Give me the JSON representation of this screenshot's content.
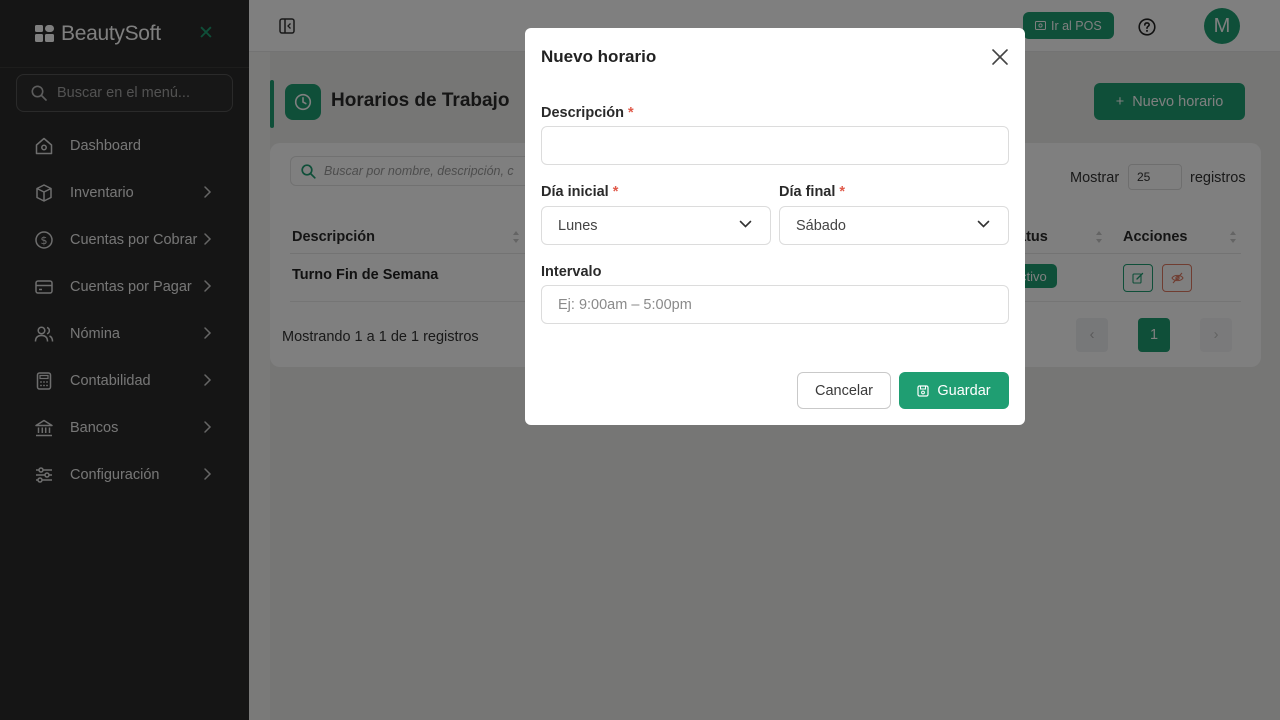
{
  "sidebar": {
    "brand": "BeautySoft",
    "search_placeholder": "Buscar en el menú...",
    "items": [
      {
        "label": "Dashboard",
        "icon": "home-icon",
        "has_chevron": false
      },
      {
        "label": "Inventario",
        "icon": "box-icon",
        "has_chevron": true
      },
      {
        "label": "Cuentas por Cobrar",
        "icon": "dollar-circle-icon",
        "has_chevron": true
      },
      {
        "label": "Cuentas por Pagar",
        "icon": "credit-card-icon",
        "has_chevron": true
      },
      {
        "label": "Nómina",
        "icon": "users-icon",
        "has_chevron": true
      },
      {
        "label": "Contabilidad",
        "icon": "calculator-icon",
        "has_chevron": true
      },
      {
        "label": "Bancos",
        "icon": "bank-icon",
        "has_chevron": true
      },
      {
        "label": "Configuración",
        "icon": "sliders-icon",
        "has_chevron": true
      }
    ]
  },
  "topbar": {
    "pos_button": "Ir al POS",
    "avatar_initial": "M"
  },
  "page": {
    "title": "Horarios de Trabajo",
    "new_button": "Nuevo horario"
  },
  "table": {
    "search_placeholder": "Buscar por nombre, descripción, c",
    "show_label": "Mostrar",
    "page_size": "25",
    "records_label": "registros",
    "headers": {
      "descripcion": "Descripción",
      "estatus": "atus",
      "acciones": "Acciones"
    },
    "rows": [
      {
        "descripcion": "Turno Fin de Semana",
        "estatus": "ctivo"
      }
    ],
    "footer_info": "Mostrando 1 a 1 de 1 registros",
    "pagination": {
      "prev": "‹",
      "current": "1",
      "next": "›"
    }
  },
  "modal": {
    "title": "Nuevo horario",
    "descripcion_label": "Descripción",
    "descripcion_value": "",
    "dia_inicial_label": "Día inicial",
    "dia_inicial_value": "Lunes",
    "dia_final_label": "Día final",
    "dia_final_value": "Sábado",
    "intervalo_label": "Intervalo",
    "intervalo_placeholder": "Ej: 9:00am – 5:00pm",
    "required_mark": "*",
    "cancel_button": "Cancelar",
    "save_button": "Guardar"
  },
  "colors": {
    "accent": "#1f9e72",
    "sidebar_bg": "#2b2b2a",
    "danger": "#e05a4a"
  }
}
